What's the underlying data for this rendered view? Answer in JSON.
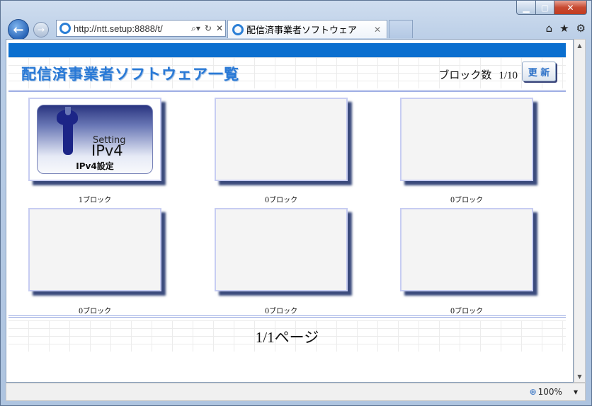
{
  "browser": {
    "address": "http://ntt.setup:8888/t/",
    "tab_title": "配信済事業者ソフトウェア",
    "zoom": "100%"
  },
  "page": {
    "heading": "配信済事業者ソフトウェア一覧",
    "block_count_label": "ブロック数",
    "block_count_value": "1/10",
    "update_button": "更 新",
    "tiles": [
      {
        "caption": "1ブロック",
        "icon": "ipv4-setting-icon",
        "setting_text": "Setting",
        "ipv_text": "IPv4",
        "label": "IPv4設定"
      },
      {
        "caption": "0ブロック"
      },
      {
        "caption": "0ブロック"
      },
      {
        "caption": "0ブロック"
      },
      {
        "caption": "0ブロック"
      },
      {
        "caption": "0ブロック"
      }
    ],
    "page_info": "1/1ページ"
  },
  "colors": {
    "accent_bar": "#0b6fcf",
    "heading_text": "#2979d6",
    "tile_shadow": "#3a4a7c"
  }
}
